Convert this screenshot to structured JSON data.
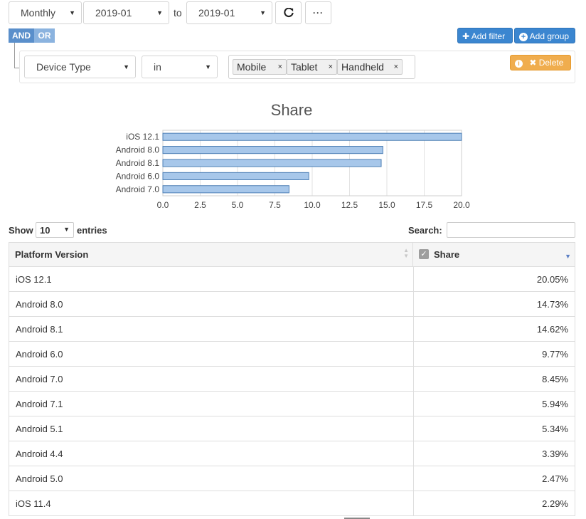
{
  "toolbar": {
    "period": "Monthly",
    "from": "2019-01",
    "to_label": "to",
    "to": "2019-01",
    "refresh_icon": "refresh-icon",
    "more_icon": "ellipsis-icon"
  },
  "filter": {
    "and_label": "AND",
    "or_label": "OR",
    "add_filter_label": "Add filter",
    "add_group_label": "Add group",
    "field": "Device Type",
    "operator": "in",
    "values": [
      "Mobile",
      "Tablet",
      "Handheld"
    ],
    "delete_label": "Delete"
  },
  "chart_data": {
    "type": "bar",
    "title": "Share",
    "categories": [
      "iOS 12.1",
      "Android 8.0",
      "Android 8.1",
      "Android 6.0",
      "Android 7.0"
    ],
    "values": [
      20.05,
      14.73,
      14.62,
      9.77,
      8.45
    ],
    "xlim": [
      0,
      20
    ],
    "xticks": [
      "0.0",
      "2.5",
      "5.0",
      "7.5",
      "10.0",
      "12.5",
      "15.0",
      "17.5",
      "20.0"
    ],
    "orientation": "horizontal",
    "grid": true,
    "bar_color": "#a7c7ea",
    "bar_border": "#4d7fb5"
  },
  "table": {
    "show_label": "Show",
    "page_size": "10",
    "entries_label": "entries",
    "search_label": "Search:",
    "search_value": "",
    "columns": [
      "Platform Version",
      "Share"
    ],
    "rows": [
      {
        "platform": "iOS 12.1",
        "share": "20.05%"
      },
      {
        "platform": "Android 8.0",
        "share": "14.73%"
      },
      {
        "platform": "Android 8.1",
        "share": "14.62%"
      },
      {
        "platform": "Android 6.0",
        "share": "9.77%"
      },
      {
        "platform": "Android 7.0",
        "share": "8.45%"
      },
      {
        "platform": "Android 7.1",
        "share": "5.94%"
      },
      {
        "platform": "Android 5.1",
        "share": "5.34%"
      },
      {
        "platform": "Android 4.4",
        "share": "3.39%"
      },
      {
        "platform": "Android 5.0",
        "share": "2.47%"
      },
      {
        "platform": "iOS 11.4",
        "share": "2.29%"
      }
    ]
  }
}
